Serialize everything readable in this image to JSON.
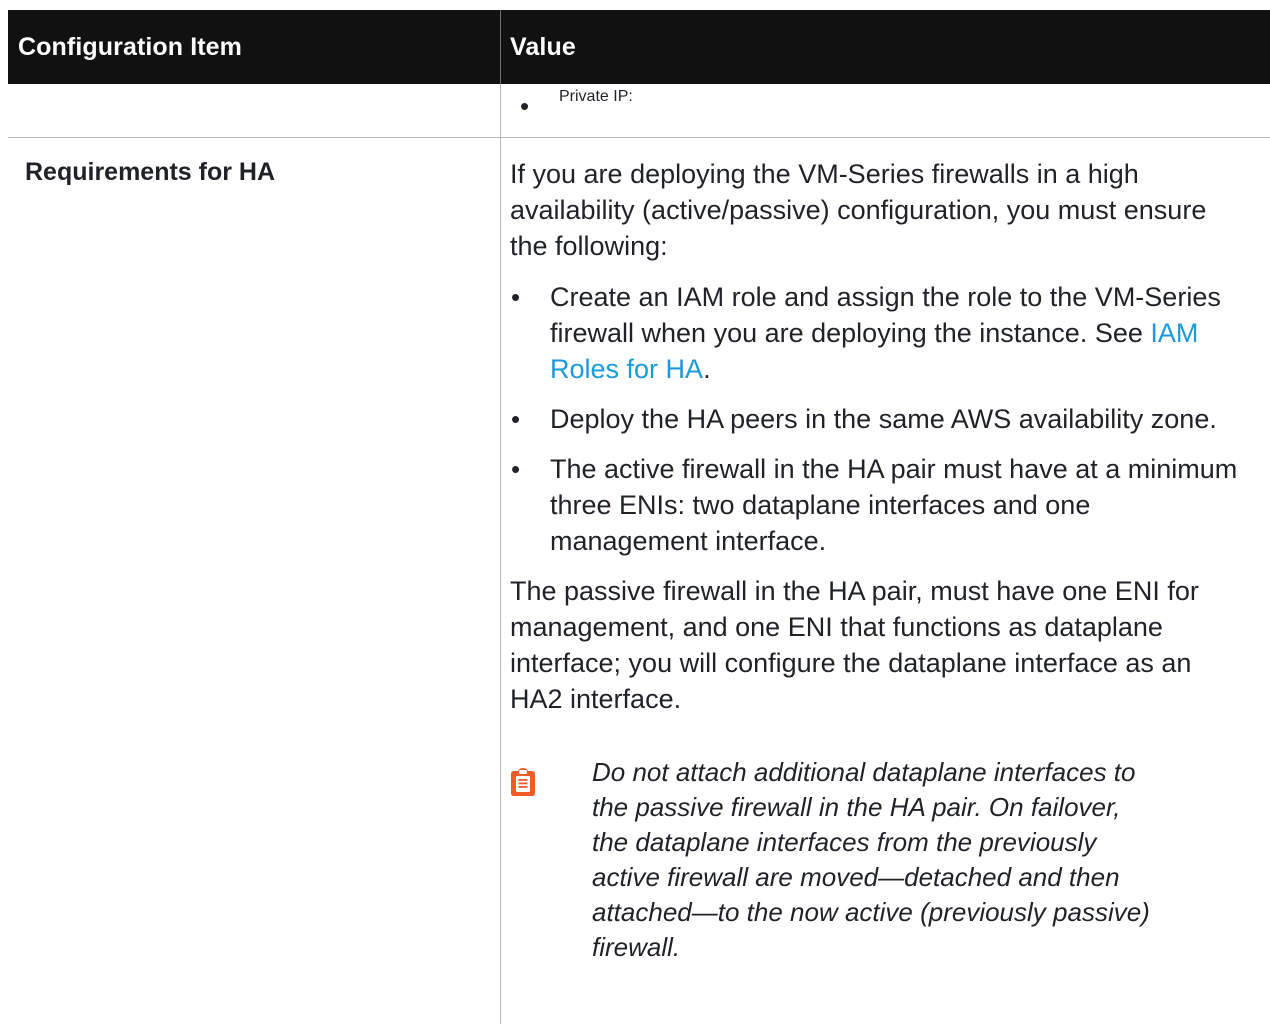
{
  "table": {
    "headers": {
      "col1": "Configuration Item",
      "col2": "Value"
    },
    "row1": {
      "value_bullet": "Private IP:"
    },
    "row2": {
      "label": "Requirements for HA",
      "intro": "If you are deploying the VM-Series firewalls in a high availability (active/passive) configuration, you must ensure the following:",
      "bullets": [
        {
          "before": "Create an IAM role and assign the role to the VM-Series firewall when you are deploying the instance. See ",
          "link": "IAM Roles for HA",
          "after": "."
        },
        {
          "text": "Deploy the HA peers in the same AWS availability zone."
        },
        {
          "text": "The active firewall in the HA pair must have at a minimum three ENIs: two dataplane interfaces and one management interface."
        }
      ],
      "passive_paragraph": "The passive firewall in the HA pair, must have one ENI for management, and one ENI that functions as dataplane interface; you will configure the dataplane interface as an HA2 interface.",
      "note": {
        "icon": "clipboard-note-icon",
        "icon_color": "#f15a29",
        "text": "Do not attach additional dataplane interfaces to the passive firewall in the HA pair. On failover, the dataplane interfaces from the previously active firewall are moved—detached and then attached—to the now active (previously passive) firewall."
      }
    }
  },
  "colors": {
    "header_bg": "#111111",
    "header_text": "#ffffff",
    "link": "#1a9ad6",
    "divider": "#b8b8b8"
  }
}
